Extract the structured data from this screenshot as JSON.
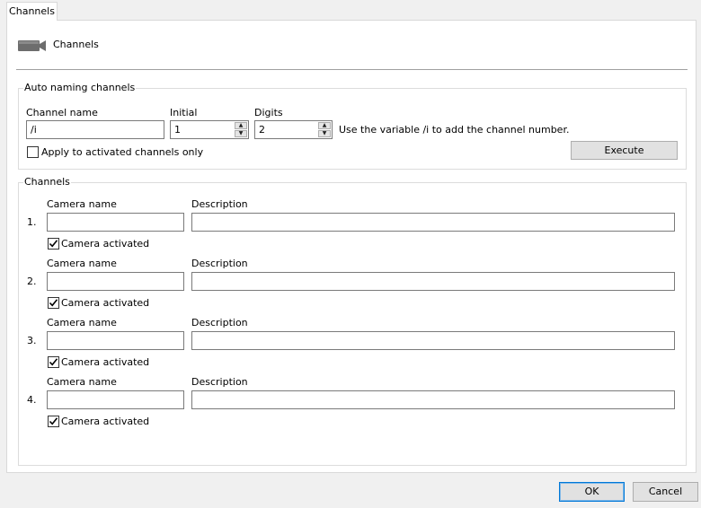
{
  "tab": {
    "label": "Channels"
  },
  "header": {
    "title": "Channels",
    "icon": "video-camera-icon"
  },
  "auto_naming": {
    "legend": "Auto naming channels",
    "channel_name_label": "Channel name",
    "channel_name_value": "/i",
    "initial_label": "Initial",
    "initial_value": "1",
    "digits_label": "Digits",
    "digits_value": "2",
    "hint": "Use the variable /i to add the channel number.",
    "apply_label": "Apply to activated channels only",
    "apply_checked": false,
    "execute_label": "Execute"
  },
  "channels": {
    "legend": "Channels",
    "camera_name_label": "Camera name",
    "description_label": "Description",
    "activated_label": "Camera activated",
    "items": [
      {
        "number": "1.",
        "camera_name": "",
        "description": "",
        "activated": true
      },
      {
        "number": "2.",
        "camera_name": "",
        "description": "",
        "activated": true
      },
      {
        "number": "3.",
        "camera_name": "",
        "description": "",
        "activated": true
      },
      {
        "number": "4.",
        "camera_name": "",
        "description": "",
        "activated": true
      }
    ]
  },
  "footer": {
    "ok_label": "OK",
    "cancel_label": "Cancel"
  },
  "colors": {
    "background": "#f0f0f0",
    "panel": "#ffffff",
    "accent": "#0078d7"
  }
}
